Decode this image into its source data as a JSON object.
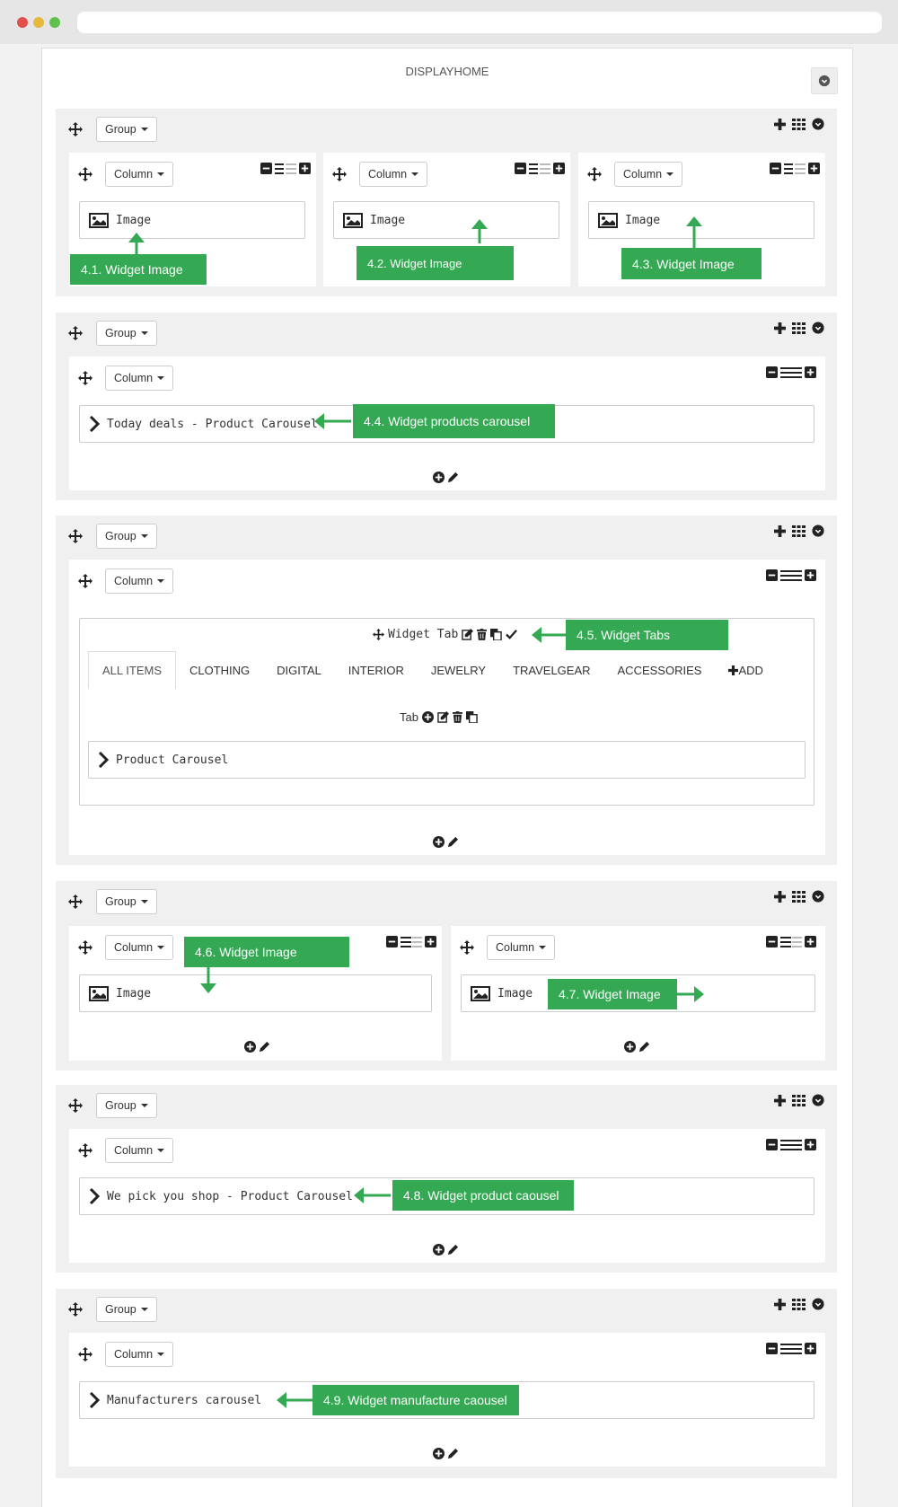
{
  "panel": {
    "title": "DISPLAYHOME"
  },
  "labels": {
    "group": "Group",
    "column": "Column",
    "image": "Image"
  },
  "group2": {
    "widget": "Today deals - Product Carousel"
  },
  "group3": {
    "widget_tab": {
      "label": "Widget Tab"
    },
    "tabs": [
      "ALL ITEMS",
      "CLOTHING",
      "DIGITAL",
      "INTERIOR",
      "JEWELRY",
      "TRAVELGEAR",
      "ACCESSORIES"
    ],
    "add_label": "ADD",
    "tab_label": "Tab",
    "widget": "Product Carousel"
  },
  "group5": {
    "widget": "We pick you shop - Product Carousel"
  },
  "group6": {
    "widget": "Manufacturers carousel"
  },
  "annotations": {
    "a1": "4.1. Widget Image",
    "a2": "4.2. Widget Image",
    "a3": "4.3. Widget Image",
    "a4": "4.4. Widget products carousel",
    "a5": "4.5. Widget Tabs",
    "a6": "4.6. Widget Image",
    "a7": "4.7. Widget Image",
    "a8": "4.8. Widget product caousel",
    "a9": "4.9. Widget manufacture caousel"
  },
  "colors": {
    "annotation": "#34a853",
    "group_bg": "#f0f0f0",
    "dot_red": "#e0504d",
    "dot_yellow": "#e6b93c",
    "dot_green": "#5fc04d"
  },
  "icons": [
    "move-icon",
    "plus-icon",
    "grid-icon",
    "circle-down-icon",
    "minus-square-icon",
    "lines-icon",
    "plus-square-icon",
    "image-icon",
    "chevron-right-icon",
    "plus-circle-icon",
    "pencil-icon",
    "edit-icon",
    "trash-icon",
    "copy-icon",
    "check-icon"
  ]
}
